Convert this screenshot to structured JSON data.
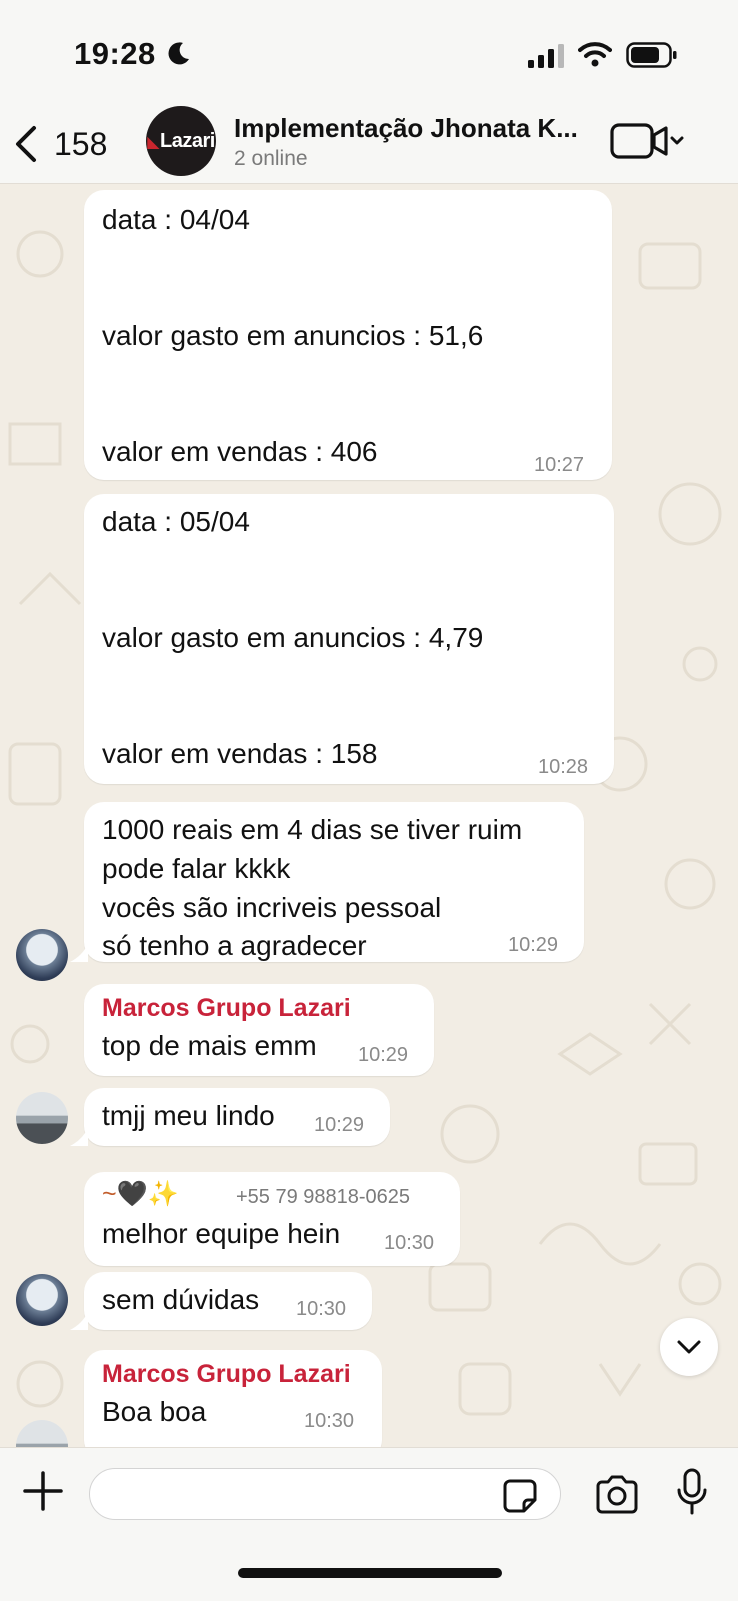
{
  "status_bar": {
    "time": "19:28"
  },
  "header": {
    "back_count": "158",
    "avatar_logo": "Lazari",
    "title": "Implementação Jhonata K...",
    "subtitle": "2 online"
  },
  "messages": [
    {
      "lines": [
        "data : 04/04",
        "",
        "",
        "valor gasto em anuncios : 51,6",
        "",
        "",
        "valor em vendas : 406"
      ],
      "time": "10:27"
    },
    {
      "lines": [
        "data : 05/04",
        "",
        "",
        "valor gasto em anuncios : 4,79",
        "",
        "",
        "valor em vendas : 158"
      ],
      "time": "10:28"
    },
    {
      "lines": [
        "1000 reais em 4 dias se tiver ruim",
        "pode falar kkkk",
        "vocês são incriveis pessoal",
        "só tenho a agradecer"
      ],
      "time": "10:29"
    },
    {
      "sender": "Marcos Grupo Lazari",
      "text": "top de mais emm",
      "time": "10:29"
    },
    {
      "text": "tmjj meu lindo",
      "time": "10:29"
    },
    {
      "sender_name": "~🖤✨",
      "sender_phone": "+55 79 98818-0625",
      "text": "melhor equipe hein",
      "time": "10:30"
    },
    {
      "text": "sem dúvidas",
      "time": "10:30"
    },
    {
      "sender": "Marcos Grupo Lazari",
      "text": "Boa boa",
      "time": "10:30"
    }
  ],
  "input": {
    "placeholder": ""
  },
  "colors": {
    "sender_red": "#c8233a",
    "background": "#f2ede4",
    "bubble": "#ffffff"
  }
}
